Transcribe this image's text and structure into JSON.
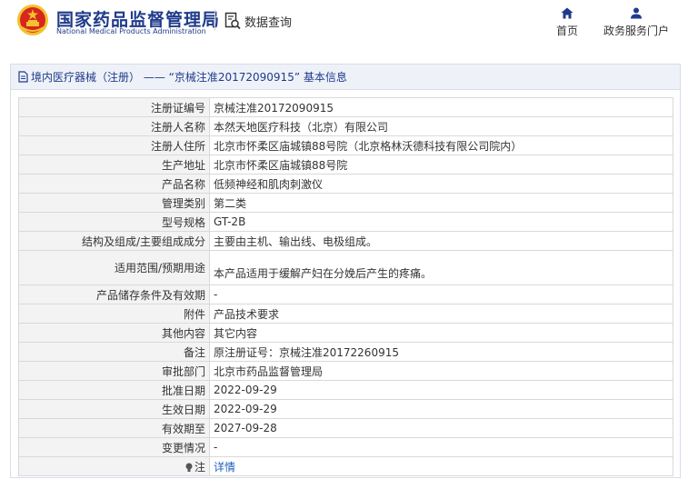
{
  "header": {
    "title_cn": "国家药品监督管理局",
    "title_en": "National Medical Products Administration",
    "query_label": "数据查询",
    "nav": {
      "home_label": "首页",
      "service_label": "政务服务门户"
    }
  },
  "panel": {
    "title": "境内医疗器械（注册） —— “京械注准20172090915” 基本信息"
  },
  "rows": [
    {
      "label": "注册证编号",
      "value": "京械注准20172090915"
    },
    {
      "label": "注册人名称",
      "value": "本然天地医疗科技（北京）有限公司"
    },
    {
      "label": "注册人住所",
      "value": "北京市怀柔区庙城镇88号院（北京格林沃德科技有限公司院内）"
    },
    {
      "label": "生产地址",
      "value": "北京市怀柔区庙城镇88号院"
    },
    {
      "label": "产品名称",
      "value": "低频神经和肌肉刺激仪"
    },
    {
      "label": "管理类别",
      "value": "第二类"
    },
    {
      "label": "型号规格",
      "value": "GT-2B"
    },
    {
      "label": "结构及组成/主要组成成分",
      "value": "主要由主机、输出线、电极组成。"
    },
    {
      "label": "适用范围/预期用途",
      "value": "本产品适用于缓解产妇在分娩后产生的疼痛。"
    },
    {
      "label": "产品储存条件及有效期",
      "value": "-"
    },
    {
      "label": "附件",
      "value": "产品技术要求"
    },
    {
      "label": "其他内容",
      "value": "其它内容"
    },
    {
      "label": "备注",
      "value": "原注册证号：京械注准20172260915"
    },
    {
      "label": "审批部门",
      "value": "北京市药品监督管理局"
    },
    {
      "label": "批准日期",
      "value": "2022-09-29"
    },
    {
      "label": "生效日期",
      "value": "2022-09-29"
    },
    {
      "label": "有效期至",
      "value": "2027-09-28"
    },
    {
      "label": "变更情况",
      "value": "-"
    }
  ],
  "note_row": {
    "label": "注",
    "link": "详情"
  },
  "icons": {
    "emblem": "national-emblem-icon",
    "query": "search-document-icon",
    "home": "home-icon",
    "user": "user-icon",
    "panel": "document-icon",
    "note": "lightbulb-icon"
  },
  "colors": {
    "brand": "#1f3a8a",
    "link": "#1f5fbf",
    "emblem_red": "#d7261e",
    "emblem_gold": "#f2c230"
  }
}
